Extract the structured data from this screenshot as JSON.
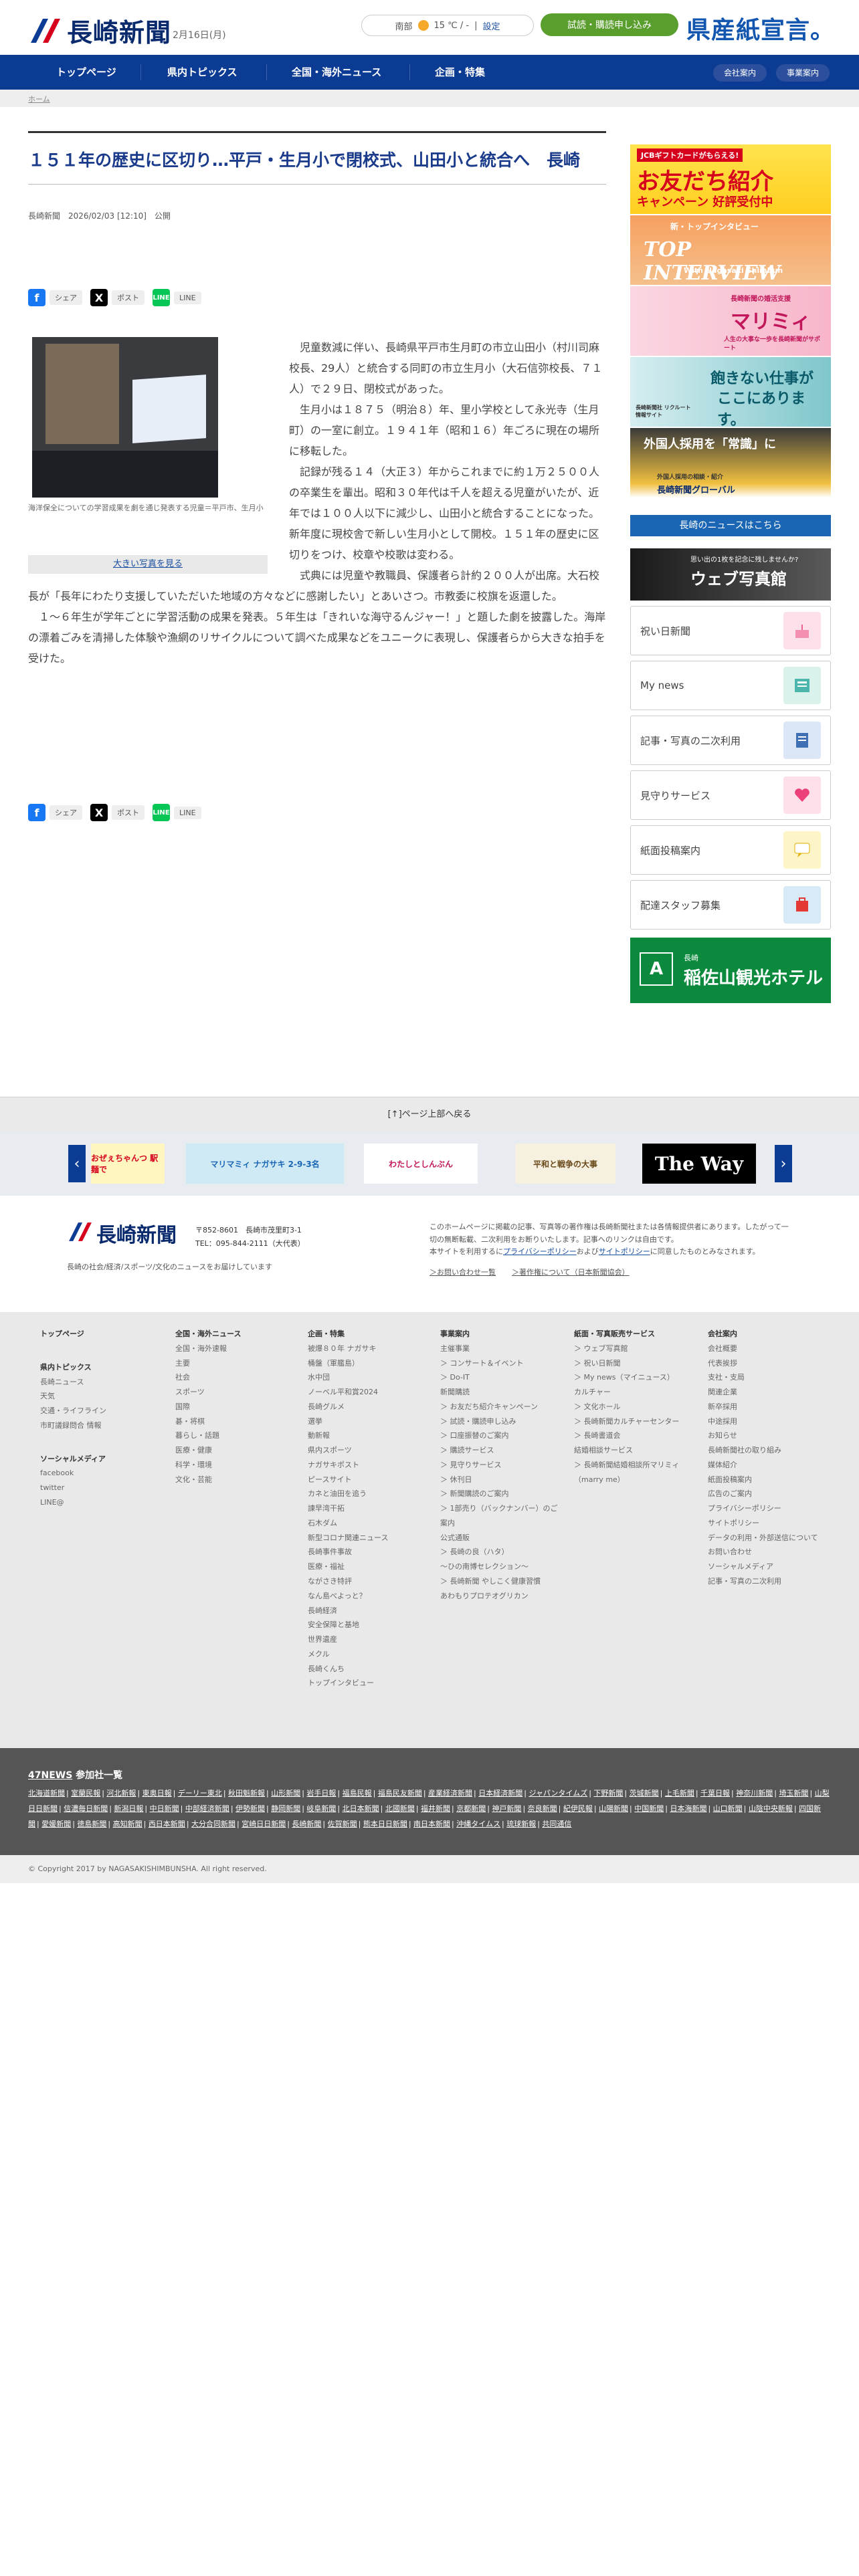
{
  "header": {
    "logo": "長崎新聞",
    "date": "2月16日(月)",
    "weather_region": "南部",
    "temperature": "15 ℃ / -",
    "weather_change": "設定",
    "trial_button": "試読・購読申し込み",
    "kensan": "県産紙宣言。"
  },
  "nav": {
    "items": [
      "トップページ",
      "県内トピックス",
      "全国・海外ニュース",
      "企画・特集"
    ],
    "company": "会社案内",
    "business": "事業案内"
  },
  "breadcrumb": "ホーム",
  "article": {
    "title": "１５１年の歴史に区切り…平戸・生月小で閉校式、山田小と統合へ　長崎",
    "byline": "長崎新聞　2026/02/03 [12:10]　公開",
    "photo_caption": "海洋保全についての学習成果を劇を通じ発表する児童＝平戸市、生月小",
    "big_photo": "大きい写真を見る",
    "paragraphs": [
      "児童数減に伴い、長崎県平戸市生月町の市立山田小（村川司麻校長、29人）と統合する同町の市立生月小（大石信弥校長、７１人）で２９日、閉校式があった。",
      "生月小は１８７５（明治８）年、里小学校として永光寺（生月町）の一室に創立。１９４１年（昭和１６）年ごろに現在の場所に移転した。",
      "記録が残る１４（大正３）年からこれまでに約１万２５００人の卒業生を輩出。昭和３０年代は千人を超える児童がいたが、近年では１００人以下に減少し、山田小と統合することになった。新年度に現校舎で新しい生月小として開校。１５１年の歴史に区切りをつけ、校章や校歌は変わる。",
      "式典には児童や教職員、保護者ら計約２００人が出席。大石校長が「長年にわたり支援していただいた地域の方々などに感謝したい」とあいさつ。市教委に校旗を返還した。",
      "１～６年生が学年ごとに学習活動の成果を発表。５年生は「きれいな海守るんジャー！」と題した劇を披露した。海岸の漂着ごみを清掃した体験や漁網のリサイクルについて調べた成果などをユニークに表現し、保護者らから大きな拍手を受けた。"
    ],
    "share": {
      "facebook": "シェア",
      "x": "ポスト",
      "line": "LINE"
    }
  },
  "sidebar": {
    "ads": [
      {
        "line1": "JCBギフトカードがもらえる!",
        "line2": "お友だち紹介",
        "line3": "キャンペーン 好評受付中"
      },
      {
        "line1": "新・トップインタビュー",
        "line2": "TOP INTERVIEW",
        "line3": "With Nagasaki Shimbun"
      },
      {
        "line1": "長崎新聞の婚活支援",
        "line2": "マリミィ",
        "line3": "人生の大事な一歩を長崎新聞がサポート"
      },
      {
        "line1": "飽きない仕事が",
        "line2": "ここにあります。",
        "line3": "長崎新聞社 リクルート 情報サイト"
      },
      {
        "line1": "外国人採用を「常識」に",
        "line2": "長崎新聞グローバル",
        "line3": "外国人採用の相談・紹介"
      }
    ],
    "news_button": "長崎のニュースはこちら",
    "photo_ad": {
      "line1": "思い出の1枚を記念に残しませんか?",
      "line2": "ウェブ写真館"
    },
    "menu": [
      "祝い日新聞",
      "My news",
      "記事・写真の二次利用",
      "見守りサービス",
      "紙面投稿案内",
      "配達スタッフ募集"
    ],
    "hotel": {
      "small": "長崎",
      "name": "稲佐山観光ホテル"
    }
  },
  "pagetop": "[↑]ページ上部へ戻る",
  "banners": [
    "おぜぇちゃんつ 駅麺で",
    "マリマミィ ナガサキ 2-9-3名",
    "わたしとしんぶん",
    "平和と戦争の大事",
    "The Way"
  ],
  "footer_info": {
    "logo": "長崎新聞",
    "postal": "〒852-8601　長崎市茂里町3-1",
    "tel": "TEL：095-844-2111（大代表）",
    "desc": "長崎の社会/経済/スポーツ/文化のニュースをお届けしています",
    "note1": "このホームページに掲載の記事、写真等の著作権は長崎新聞社または各情報提供者にあります。したがって一切の無断転載、二次利用をお断りいたします。記事へのリンクは自由です。",
    "note2_pre": "本サイトを利用するに",
    "privacy": "プライバシーポリシー",
    "note2_mid": "および",
    "sitepolicy": "サイトポリシー",
    "note2_post": "に同意したものとみなされます。",
    "contact": "＞お問い合わせ一覧",
    "copyright_link": "＞著作権について（日本新聞協会）"
  },
  "sitemap": {
    "col1": {
      "h1": "トップページ",
      "h2": "県内トピックス",
      "items2": [
        "長崎ニュース",
        "天気",
        "交通・ライフライン",
        "市町議録問合 情報"
      ],
      "h3": "ソーシャルメディア",
      "items3": [
        "facebook",
        "twitter",
        "LINE@"
      ]
    },
    "col2": {
      "h": "全国・海外ニュース",
      "items": [
        "全国・海外速報",
        "主要",
        "社会",
        "スポーツ",
        "国際",
        "碁・将棋",
        "暮らし・話題",
        "医療・健康",
        "科学・環境",
        "文化・芸能"
      ]
    },
    "col3": {
      "h": "企画・特集",
      "items": [
        "被爆８０年 ナガサキ",
        "桶盤（軍艦島）",
        "水中団",
        "ノーベル平和賞2024",
        "長崎グルメ",
        "選挙",
        "動新報",
        "県内スポーツ",
        "ナガサキポスト",
        "ピースサイト",
        "カネと油田を追う",
        "諫早湾干拓",
        "石木ダム",
        "新型コロナ関連ニュース",
        "長崎事件事故",
        "医療・福祉",
        "ながさき特評",
        "なん島べよっと？",
        "長崎経済",
        "安全保障と基地",
        "世界遺産",
        "メクル",
        "長崎くんち",
        "トップインタビュー"
      ]
    },
    "col4": {
      "h": "事業案内",
      "sub1": "主催事業",
      "items1": [
        "＞ コンサート＆イベント",
        "＞ Do-IT"
      ],
      "sub2": "新聞購読",
      "items2": [
        "＞ お友だち紹介キャンペーン",
        "＞ 試読・購読申し込み",
        "＞ 口座振替のご案内",
        "＞ 購読サービス",
        "＞ 見守りサービス",
        "＞ 休刊日",
        "＞ 新聞購読のご案内",
        "＞ 1部売り（バックナンバー）のご案内"
      ],
      "sub3": "公式通販",
      "items3": [
        "＞ 長崎の良（ハタ）",
        "〜ひの南博セレクション〜",
        "＞ 長崎新聞 やしこく健康習慣",
        "あわもりプロテオグリカン"
      ]
    },
    "col5": {
      "h": "紙面・写真販売サービス",
      "items1": [
        "＞ ウェブ写真館",
        "＞ 祝い日新聞",
        "＞ My news（マイニュース）"
      ],
      "sub2": "カルチャー",
      "items2": [
        "＞ 文化ホール",
        "＞ 長崎新聞カルチャーセンター",
        "＞ 長崎書道会"
      ],
      "sub3": "結婚相談サービス",
      "items3": [
        "＞ 長崎新聞結婚相談所マリミィ（marry me）"
      ]
    },
    "col6": {
      "h": "会社案内",
      "items": [
        "会社概要",
        "代表挨拶",
        "支社・支局",
        "関連企業",
        "新卒採用",
        "中途採用",
        "お知らせ",
        "長崎新聞社の取り組み",
        "媒体紹介",
        "紙面投稿案内",
        "広告のご案内",
        "プライバシーポリシー",
        "サイトポリシー",
        "データの利用・外部送信について",
        "お問い合わせ",
        "ソーシャルメディア",
        "記事・写真の二次利用"
      ]
    }
  },
  "news47": {
    "title_prefix": "47NEWS",
    "title_suffix": " 参加社一覧",
    "papers": [
      "北海道新聞",
      "室蘭民報",
      "河北新報",
      "東奥日報",
      "デーリー東北",
      "秋田魁新報",
      "山形新聞",
      "岩手日報",
      "福島民報",
      "福島民友新聞",
      "産業経済新聞",
      "日本経済新聞",
      "ジャパンタイムズ",
      "下野新聞",
      "茨城新聞",
      "上毛新聞",
      "千葉日報",
      "神奈川新聞",
      "埼玉新聞",
      "山梨日日新聞",
      "信濃毎日新聞",
      "新潟日報",
      "中日新聞",
      "中部経済新聞",
      "伊勢新聞",
      "静岡新聞",
      "岐阜新聞",
      "北日本新聞",
      "北國新聞",
      "福井新聞",
      "京都新聞",
      "神戸新聞",
      "奈良新聞",
      "紀伊民報",
      "山陽新聞",
      "中国新聞",
      "日本海新聞",
      "山口新聞",
      "山陰中央新報",
      "四国新聞",
      "愛媛新聞",
      "徳島新聞",
      "高知新聞",
      "西日本新聞",
      "大分合同新聞",
      "宮崎日日新聞",
      "長崎新聞",
      "佐賀新聞",
      "熊本日日新聞",
      "南日本新聞",
      "沖縄タイムス",
      "琉球新報",
      "共同通信"
    ]
  },
  "copyright": "© Copyright 2017 by NAGASAKISHIMBUNSHA. All right reserved.",
  "colors": {
    "brand_blue": "#0c3b94",
    "accent_red": "#d6001c",
    "green": "#5a9e2e"
  }
}
